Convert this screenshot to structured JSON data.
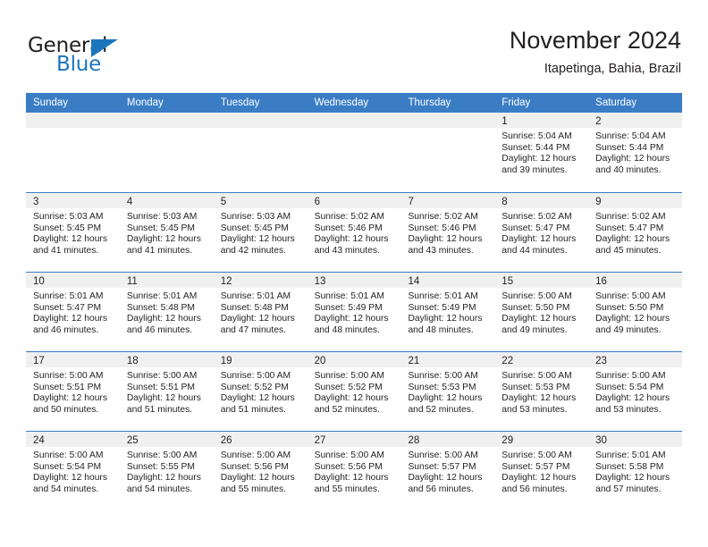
{
  "brand": {
    "name_part1": "General",
    "name_part2": "Blue",
    "triangle_color": "#1b75bb"
  },
  "header": {
    "title": "November 2024",
    "subtitle": "Itapetinga, Bahia, Brazil"
  },
  "theme": {
    "header_blue": "#3b7dc4",
    "day_strip_gray": "#f0f0f0",
    "text_color": "#231f20"
  },
  "weekdays": [
    "Sunday",
    "Monday",
    "Tuesday",
    "Wednesday",
    "Thursday",
    "Friday",
    "Saturday"
  ],
  "weeks": [
    [
      {
        "day": "",
        "sunrise": "",
        "sunset": "",
        "daylight_line1": "",
        "daylight_line2": ""
      },
      {
        "day": "",
        "sunrise": "",
        "sunset": "",
        "daylight_line1": "",
        "daylight_line2": ""
      },
      {
        "day": "",
        "sunrise": "",
        "sunset": "",
        "daylight_line1": "",
        "daylight_line2": ""
      },
      {
        "day": "",
        "sunrise": "",
        "sunset": "",
        "daylight_line1": "",
        "daylight_line2": ""
      },
      {
        "day": "",
        "sunrise": "",
        "sunset": "",
        "daylight_line1": "",
        "daylight_line2": ""
      },
      {
        "day": "1",
        "sunrise": "Sunrise: 5:04 AM",
        "sunset": "Sunset: 5:44 PM",
        "daylight_line1": "Daylight: 12 hours",
        "daylight_line2": "and 39 minutes."
      },
      {
        "day": "2",
        "sunrise": "Sunrise: 5:04 AM",
        "sunset": "Sunset: 5:44 PM",
        "daylight_line1": "Daylight: 12 hours",
        "daylight_line2": "and 40 minutes."
      }
    ],
    [
      {
        "day": "3",
        "sunrise": "Sunrise: 5:03 AM",
        "sunset": "Sunset: 5:45 PM",
        "daylight_line1": "Daylight: 12 hours",
        "daylight_line2": "and 41 minutes."
      },
      {
        "day": "4",
        "sunrise": "Sunrise: 5:03 AM",
        "sunset": "Sunset: 5:45 PM",
        "daylight_line1": "Daylight: 12 hours",
        "daylight_line2": "and 41 minutes."
      },
      {
        "day": "5",
        "sunrise": "Sunrise: 5:03 AM",
        "sunset": "Sunset: 5:45 PM",
        "daylight_line1": "Daylight: 12 hours",
        "daylight_line2": "and 42 minutes."
      },
      {
        "day": "6",
        "sunrise": "Sunrise: 5:02 AM",
        "sunset": "Sunset: 5:46 PM",
        "daylight_line1": "Daylight: 12 hours",
        "daylight_line2": "and 43 minutes."
      },
      {
        "day": "7",
        "sunrise": "Sunrise: 5:02 AM",
        "sunset": "Sunset: 5:46 PM",
        "daylight_line1": "Daylight: 12 hours",
        "daylight_line2": "and 43 minutes."
      },
      {
        "day": "8",
        "sunrise": "Sunrise: 5:02 AM",
        "sunset": "Sunset: 5:47 PM",
        "daylight_line1": "Daylight: 12 hours",
        "daylight_line2": "and 44 minutes."
      },
      {
        "day": "9",
        "sunrise": "Sunrise: 5:02 AM",
        "sunset": "Sunset: 5:47 PM",
        "daylight_line1": "Daylight: 12 hours",
        "daylight_line2": "and 45 minutes."
      }
    ],
    [
      {
        "day": "10",
        "sunrise": "Sunrise: 5:01 AM",
        "sunset": "Sunset: 5:47 PM",
        "daylight_line1": "Daylight: 12 hours",
        "daylight_line2": "and 46 minutes."
      },
      {
        "day": "11",
        "sunrise": "Sunrise: 5:01 AM",
        "sunset": "Sunset: 5:48 PM",
        "daylight_line1": "Daylight: 12 hours",
        "daylight_line2": "and 46 minutes."
      },
      {
        "day": "12",
        "sunrise": "Sunrise: 5:01 AM",
        "sunset": "Sunset: 5:48 PM",
        "daylight_line1": "Daylight: 12 hours",
        "daylight_line2": "and 47 minutes."
      },
      {
        "day": "13",
        "sunrise": "Sunrise: 5:01 AM",
        "sunset": "Sunset: 5:49 PM",
        "daylight_line1": "Daylight: 12 hours",
        "daylight_line2": "and 48 minutes."
      },
      {
        "day": "14",
        "sunrise": "Sunrise: 5:01 AM",
        "sunset": "Sunset: 5:49 PM",
        "daylight_line1": "Daylight: 12 hours",
        "daylight_line2": "and 48 minutes."
      },
      {
        "day": "15",
        "sunrise": "Sunrise: 5:00 AM",
        "sunset": "Sunset: 5:50 PM",
        "daylight_line1": "Daylight: 12 hours",
        "daylight_line2": "and 49 minutes."
      },
      {
        "day": "16",
        "sunrise": "Sunrise: 5:00 AM",
        "sunset": "Sunset: 5:50 PM",
        "daylight_line1": "Daylight: 12 hours",
        "daylight_line2": "and 49 minutes."
      }
    ],
    [
      {
        "day": "17",
        "sunrise": "Sunrise: 5:00 AM",
        "sunset": "Sunset: 5:51 PM",
        "daylight_line1": "Daylight: 12 hours",
        "daylight_line2": "and 50 minutes."
      },
      {
        "day": "18",
        "sunrise": "Sunrise: 5:00 AM",
        "sunset": "Sunset: 5:51 PM",
        "daylight_line1": "Daylight: 12 hours",
        "daylight_line2": "and 51 minutes."
      },
      {
        "day": "19",
        "sunrise": "Sunrise: 5:00 AM",
        "sunset": "Sunset: 5:52 PM",
        "daylight_line1": "Daylight: 12 hours",
        "daylight_line2": "and 51 minutes."
      },
      {
        "day": "20",
        "sunrise": "Sunrise: 5:00 AM",
        "sunset": "Sunset: 5:52 PM",
        "daylight_line1": "Daylight: 12 hours",
        "daylight_line2": "and 52 minutes."
      },
      {
        "day": "21",
        "sunrise": "Sunrise: 5:00 AM",
        "sunset": "Sunset: 5:53 PM",
        "daylight_line1": "Daylight: 12 hours",
        "daylight_line2": "and 52 minutes."
      },
      {
        "day": "22",
        "sunrise": "Sunrise: 5:00 AM",
        "sunset": "Sunset: 5:53 PM",
        "daylight_line1": "Daylight: 12 hours",
        "daylight_line2": "and 53 minutes."
      },
      {
        "day": "23",
        "sunrise": "Sunrise: 5:00 AM",
        "sunset": "Sunset: 5:54 PM",
        "daylight_line1": "Daylight: 12 hours",
        "daylight_line2": "and 53 minutes."
      }
    ],
    [
      {
        "day": "24",
        "sunrise": "Sunrise: 5:00 AM",
        "sunset": "Sunset: 5:54 PM",
        "daylight_line1": "Daylight: 12 hours",
        "daylight_line2": "and 54 minutes."
      },
      {
        "day": "25",
        "sunrise": "Sunrise: 5:00 AM",
        "sunset": "Sunset: 5:55 PM",
        "daylight_line1": "Daylight: 12 hours",
        "daylight_line2": "and 54 minutes."
      },
      {
        "day": "26",
        "sunrise": "Sunrise: 5:00 AM",
        "sunset": "Sunset: 5:56 PM",
        "daylight_line1": "Daylight: 12 hours",
        "daylight_line2": "and 55 minutes."
      },
      {
        "day": "27",
        "sunrise": "Sunrise: 5:00 AM",
        "sunset": "Sunset: 5:56 PM",
        "daylight_line1": "Daylight: 12 hours",
        "daylight_line2": "and 55 minutes."
      },
      {
        "day": "28",
        "sunrise": "Sunrise: 5:00 AM",
        "sunset": "Sunset: 5:57 PM",
        "daylight_line1": "Daylight: 12 hours",
        "daylight_line2": "and 56 minutes."
      },
      {
        "day": "29",
        "sunrise": "Sunrise: 5:00 AM",
        "sunset": "Sunset: 5:57 PM",
        "daylight_line1": "Daylight: 12 hours",
        "daylight_line2": "and 56 minutes."
      },
      {
        "day": "30",
        "sunrise": "Sunrise: 5:01 AM",
        "sunset": "Sunset: 5:58 PM",
        "daylight_line1": "Daylight: 12 hours",
        "daylight_line2": "and 57 minutes."
      }
    ]
  ]
}
